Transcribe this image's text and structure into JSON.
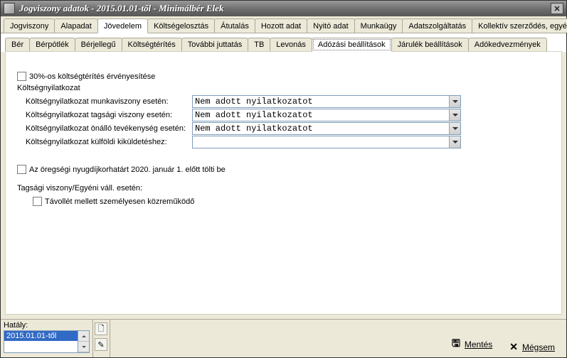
{
  "titlebar": {
    "title": "Jogviszony adatok - 2015.01.01-től - Minimálbér Elek"
  },
  "mainTabs": [
    {
      "label": "Jogviszony"
    },
    {
      "label": "Alapadat"
    },
    {
      "label": "Jövedelem",
      "active": true
    },
    {
      "label": "Költségelosztás"
    },
    {
      "label": "Átutalás"
    },
    {
      "label": "Hozott adat"
    },
    {
      "label": "Nyitó adat"
    },
    {
      "label": "Munkaügy"
    },
    {
      "label": "Adatszolgáltatás"
    },
    {
      "label": "Kollektív szerződés, egyéb"
    }
  ],
  "subTabs": [
    {
      "label": "Bér"
    },
    {
      "label": "Bérpótlék"
    },
    {
      "label": "Bérjellegű"
    },
    {
      "label": "Költségtérítés"
    },
    {
      "label": "További juttatás"
    },
    {
      "label": "TB"
    },
    {
      "label": "Levonás"
    },
    {
      "label": "Adózási beállítások",
      "active": true
    },
    {
      "label": "Járulék beállítások"
    },
    {
      "label": "Adókedvezmények"
    }
  ],
  "form": {
    "chk30": "30%-os költségtérítés érvényesítése",
    "sectionLabel": "Költségnyilatkozat",
    "rows": [
      {
        "label": "Költségnyilatkozat munkaviszony esetén:",
        "value": "Nem adott nyilatkozatot"
      },
      {
        "label": "Költségnyilatkozat tagsági viszony esetén:",
        "value": "Nem adott nyilatkozatot"
      },
      {
        "label": "Költségnyilatkozat önálló tevékenység esetén:",
        "value": "Nem adott nyilatkozatot"
      },
      {
        "label": "Költségnyilatkozat külföldi kiküldetéshez:",
        "value": ""
      }
    ],
    "chkPension": "Az öregségi nyugdíjkorhatárt 2020. január 1. előtt tölti be",
    "groupLabel": "Tagsági viszony/Egyéni váll. esetén:",
    "chkPresence": "Távollét mellett személyesen közreműködő"
  },
  "hataly": {
    "label": "Hatály:",
    "item": "2015.01.01-től"
  },
  "footer": {
    "save": "Mentés",
    "cancel": "Mégsem"
  }
}
